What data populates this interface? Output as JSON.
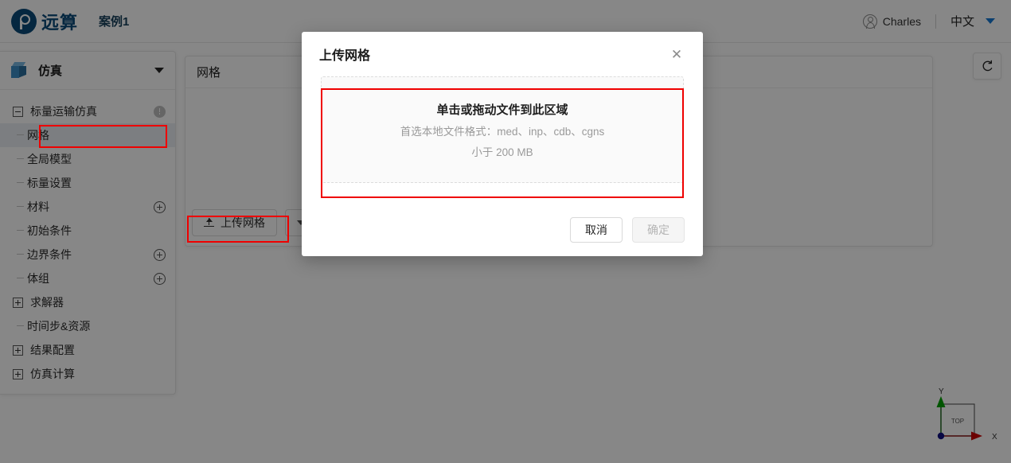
{
  "header": {
    "logo_text": "远算",
    "logo_icon": "remote-compute-logo-icon",
    "case_title": "案例1",
    "user_name": "Charles",
    "user_icon": "user-circle-icon",
    "language": "中文",
    "language_caret_icon": "chevron-down-icon",
    "language_caret_color": "#1677d2"
  },
  "sidebar": {
    "header_label": "仿真",
    "header_icon": "cube-icon",
    "header_caret_icon": "chevron-down-icon",
    "tree": [
      {
        "label": "标量运输仿真",
        "level": 0,
        "toggle": "minus",
        "trailing": "info-icon",
        "selected": false
      },
      {
        "label": "网格",
        "level": 1,
        "toggle": "none",
        "trailing": "none",
        "selected": true
      },
      {
        "label": "全局模型",
        "level": 1,
        "toggle": "none",
        "trailing": "none",
        "selected": false
      },
      {
        "label": "标量设置",
        "level": 1,
        "toggle": "none",
        "trailing": "none",
        "selected": false
      },
      {
        "label": "材料",
        "level": 1,
        "toggle": "none",
        "trailing": "plus-icon",
        "selected": false
      },
      {
        "label": "初始条件",
        "level": 1,
        "toggle": "none",
        "trailing": "none",
        "selected": false
      },
      {
        "label": "边界条件",
        "level": 1,
        "toggle": "none",
        "trailing": "plus-icon",
        "selected": false
      },
      {
        "label": "体组",
        "level": 1,
        "toggle": "none",
        "trailing": "plus-icon",
        "selected": false
      },
      {
        "label": "求解器",
        "level": 0,
        "toggle": "plus",
        "trailing": "none",
        "selected": false
      },
      {
        "label": "时间步&资源",
        "level": 1,
        "toggle": "none",
        "trailing": "none",
        "selected": false
      },
      {
        "label": "结果配置",
        "level": 0,
        "toggle": "plus",
        "trailing": "none",
        "selected": false
      },
      {
        "label": "仿真计算",
        "level": 0,
        "toggle": "plus",
        "trailing": "none",
        "selected": false
      }
    ]
  },
  "mesh_panel": {
    "title": "网格",
    "upload_button_label": "上传网格",
    "upload_button_icon": "upload-icon",
    "secondary_button_icon": "chevron-down-icon"
  },
  "viewport": {
    "reset_icon": "refresh-reset-icon",
    "axis": {
      "x_label": "X",
      "y_label": "Y",
      "face_label": "TOP",
      "x_color": "#cc0000",
      "y_color": "#00a000",
      "origin_color": "#101080"
    }
  },
  "modal": {
    "title": "上传网格",
    "close_icon": "close-icon",
    "dropzone": {
      "primary_text": "单击或拖动文件到此区域",
      "format_text": "首选本地文件格式：med、inp、cdb、cgns",
      "size_text": "小于 200 MB"
    },
    "cancel_label": "取消",
    "confirm_label": "确定"
  },
  "highlights": {
    "color": "#ef0000",
    "regions": [
      "mesh-tree-item",
      "upload-mesh-button",
      "dropzone"
    ]
  }
}
